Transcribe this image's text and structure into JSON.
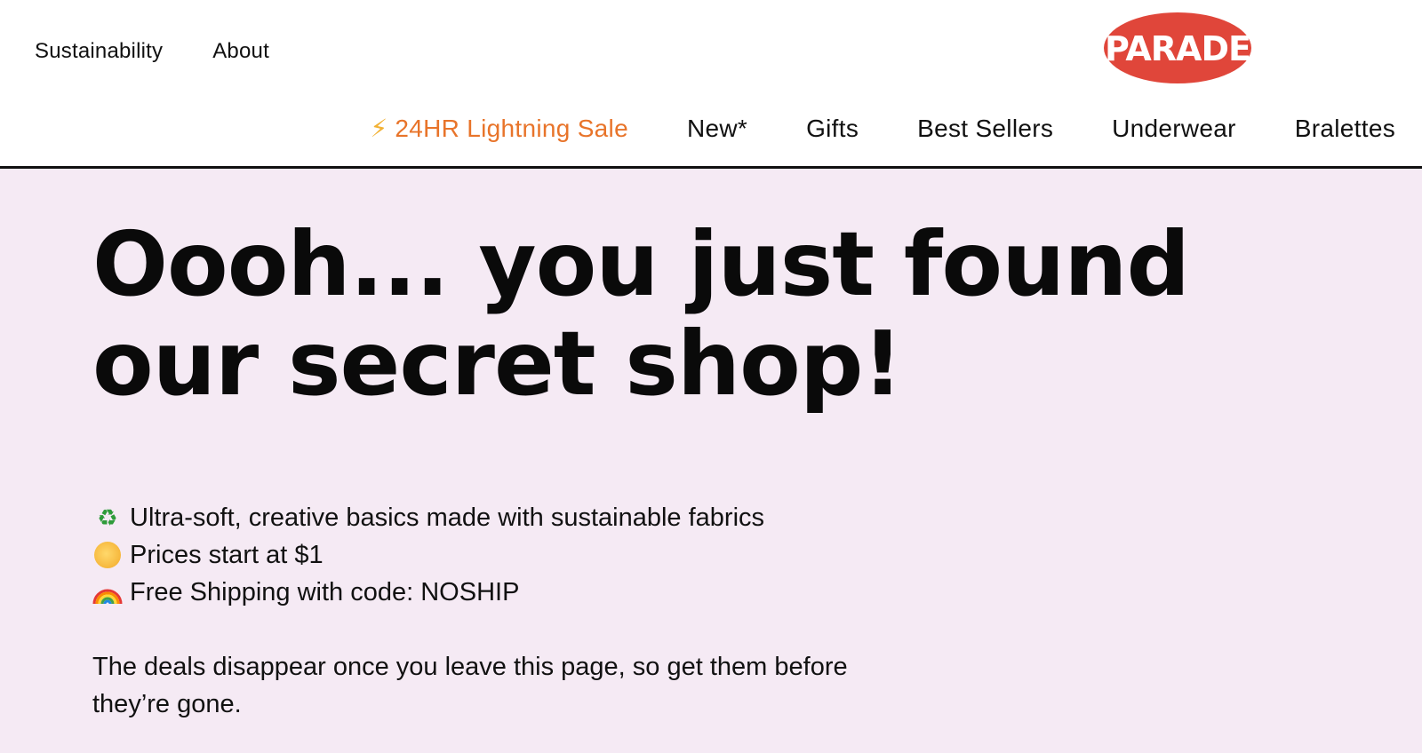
{
  "header": {
    "top_links": [
      "Sustainability",
      "About"
    ],
    "logo_text": "PARADE",
    "nav": {
      "sale_icon": "⚡",
      "sale_label": "24HR Lightning Sale",
      "items": [
        "New*",
        "Gifts",
        "Best Sellers",
        "Underwear",
        "Bralettes"
      ]
    }
  },
  "hero": {
    "title": "Oooh... you just found our secret shop!",
    "features": [
      {
        "icon": "recycle-icon",
        "text": "Ultra-soft, creative basics made with sustainable fabrics"
      },
      {
        "icon": "sun-icon",
        "text": "Prices start at $1"
      },
      {
        "icon": "rainbow-icon",
        "text": "Free Shipping with code: NOSHIP"
      }
    ],
    "note": "The deals disappear once you leave this page, so get them before they’re gone."
  },
  "colors": {
    "hero_bg": "#f5eaf4",
    "logo_red": "#e0463a",
    "sale_orange": "#e8742a",
    "text": "#111111"
  }
}
